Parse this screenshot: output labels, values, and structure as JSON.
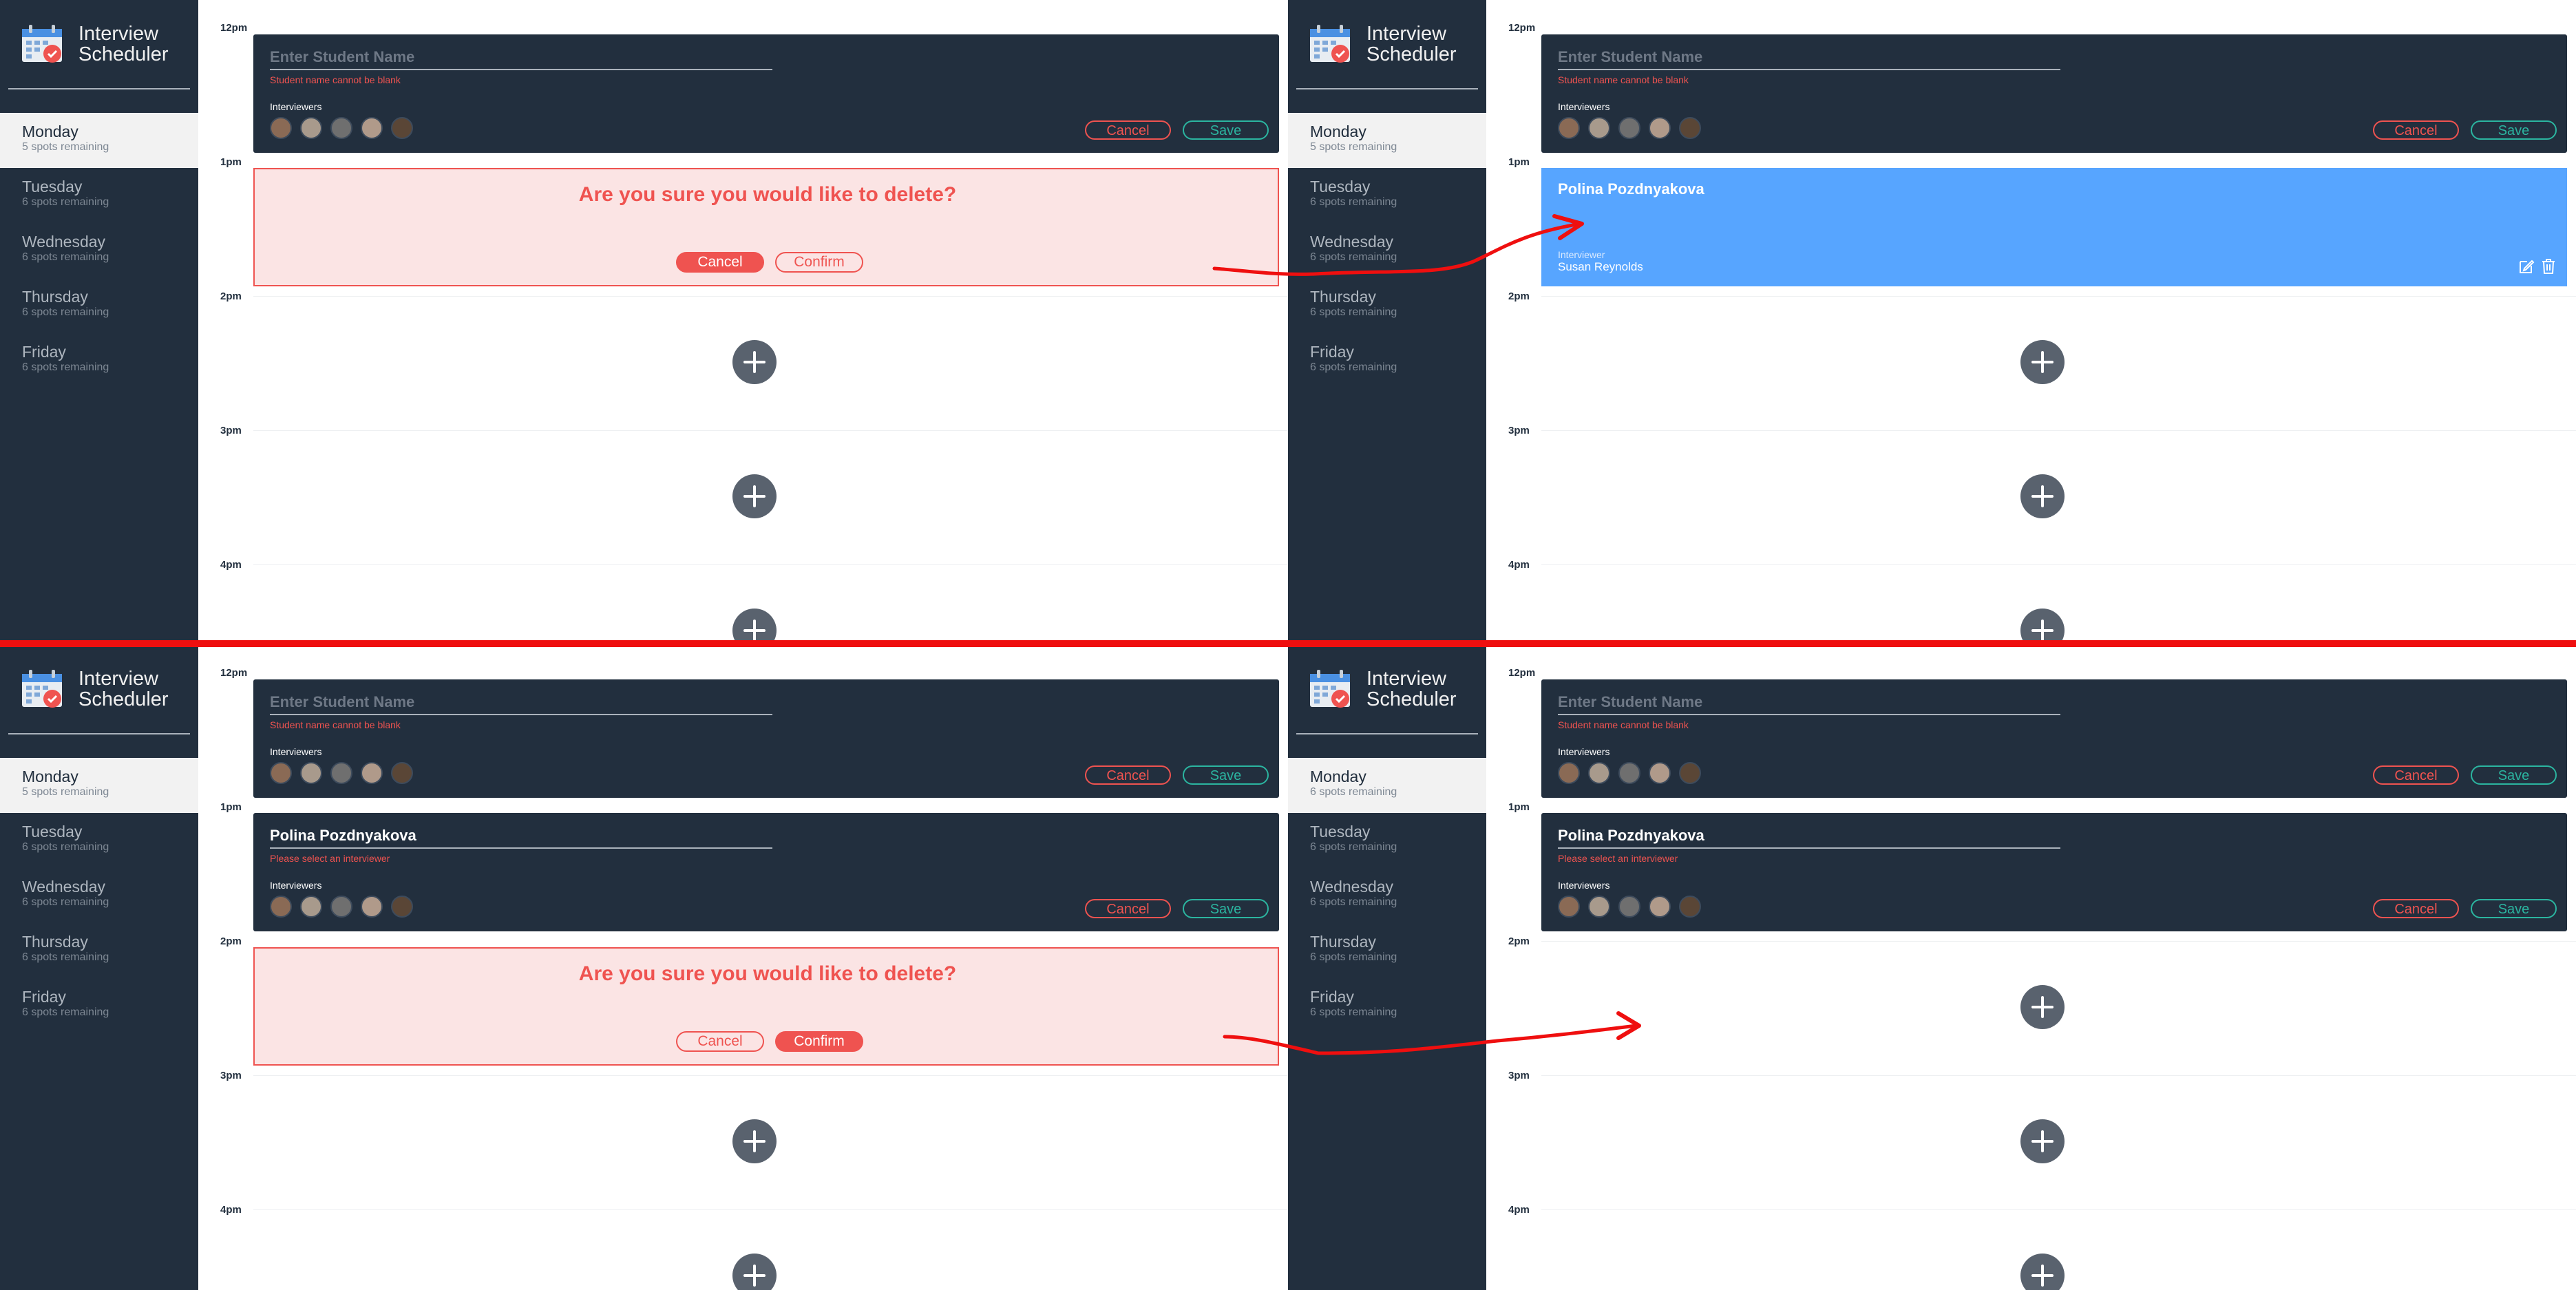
{
  "brand": {
    "line1": "Interview",
    "line2": "Scheduler"
  },
  "times": [
    "12pm",
    "1pm",
    "2pm",
    "3pm",
    "4pm"
  ],
  "interviewers_label": "Interviewers",
  "colors": {
    "sidebar": "#222f3e",
    "danger": "#ef5350",
    "success": "#2bb5a0",
    "show": "#57a5ff",
    "arrow": "#ef0f0f"
  },
  "icons": [
    "calendar-icon",
    "edit-icon",
    "trash-icon",
    "plus-icon",
    "avatar"
  ],
  "panels": {
    "tl": {
      "days": [
        {
          "name": "Monday",
          "spots": "5 spots remaining"
        },
        {
          "name": "Tuesday",
          "spots": "6 spots remaining"
        },
        {
          "name": "Wednesday",
          "spots": "6 spots remaining"
        },
        {
          "name": "Thursday",
          "spots": "6 spots remaining"
        },
        {
          "name": "Friday",
          "spots": "6 spots remaining"
        }
      ],
      "form1": {
        "placeholder": "Enter Student Name",
        "error": "Student name cannot be blank",
        "cancel": "Cancel",
        "save": "Save"
      },
      "confirm": {
        "message": "Are you sure you would like to delete?",
        "cancel": "Cancel",
        "confirm": "Confirm"
      }
    },
    "tr": {
      "days": [
        {
          "name": "Monday",
          "spots": "5 spots remaining"
        },
        {
          "name": "Tuesday",
          "spots": "6 spots remaining"
        },
        {
          "name": "Wednesday",
          "spots": "6 spots remaining"
        },
        {
          "name": "Thursday",
          "spots": "6 spots remaining"
        },
        {
          "name": "Friday",
          "spots": "6 spots remaining"
        }
      ],
      "form1": {
        "placeholder": "Enter Student Name",
        "error": "Student name cannot be blank",
        "cancel": "Cancel",
        "save": "Save"
      },
      "show": {
        "student": "Polina Pozdnyakova",
        "interviewer_label": "Interviewer",
        "interviewer": "Susan Reynolds"
      }
    },
    "bl": {
      "days": [
        {
          "name": "Monday",
          "spots": "5 spots remaining"
        },
        {
          "name": "Tuesday",
          "spots": "6 spots remaining"
        },
        {
          "name": "Wednesday",
          "spots": "6 spots remaining"
        },
        {
          "name": "Thursday",
          "spots": "6 spots remaining"
        },
        {
          "name": "Friday",
          "spots": "6 spots remaining"
        }
      ],
      "form1": {
        "placeholder": "Enter Student Name",
        "error": "Student name cannot be blank",
        "cancel": "Cancel",
        "save": "Save"
      },
      "form2": {
        "value": "Polina Pozdnyakova",
        "error": "Please select an interviewer",
        "cancel": "Cancel",
        "save": "Save"
      },
      "confirm": {
        "message": "Are you sure you would like to delete?",
        "cancel": "Cancel",
        "confirm": "Confirm"
      }
    },
    "br": {
      "days": [
        {
          "name": "Monday",
          "spots": "6 spots remaining"
        },
        {
          "name": "Tuesday",
          "spots": "6 spots remaining"
        },
        {
          "name": "Wednesday",
          "spots": "6 spots remaining"
        },
        {
          "name": "Thursday",
          "spots": "6 spots remaining"
        },
        {
          "name": "Friday",
          "spots": "6 spots remaining"
        }
      ],
      "form1": {
        "placeholder": "Enter Student Name",
        "error": "Student name cannot be blank",
        "cancel": "Cancel",
        "save": "Save"
      },
      "form2": {
        "value": "Polina Pozdnyakova",
        "error": "Please select an interviewer",
        "cancel": "Cancel",
        "save": "Save"
      }
    }
  }
}
